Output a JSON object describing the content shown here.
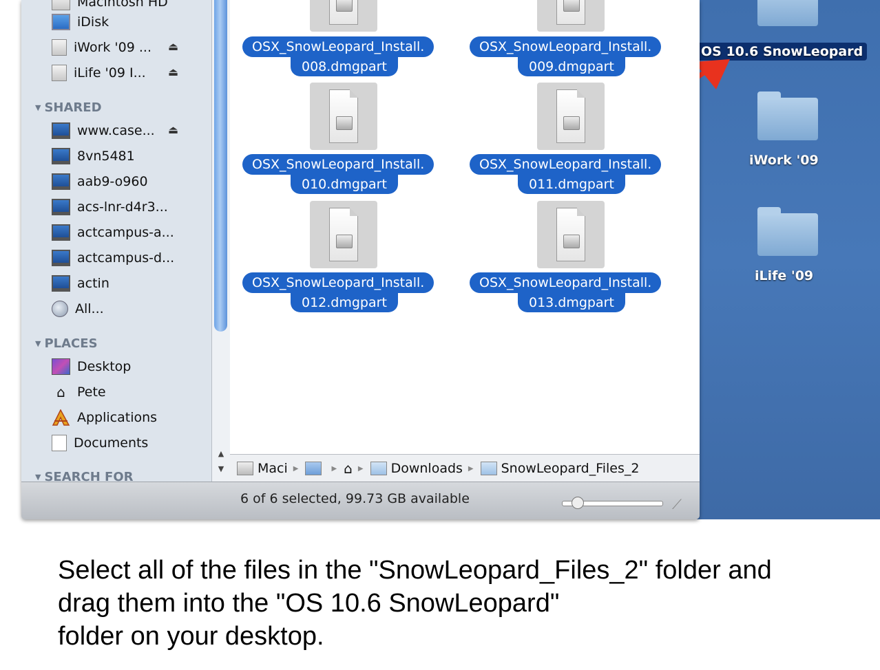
{
  "sidebar": {
    "devices": [
      {
        "label": "Macintosh HD",
        "icon": "hard-disk-icon"
      },
      {
        "label": "iDisk",
        "icon": "idisk-icon"
      },
      {
        "label": "iWork '09 ...",
        "icon": "disk-image-icon",
        "eject": true
      },
      {
        "label": "iLife '09 I...",
        "icon": "disk-image-icon",
        "eject": true
      }
    ],
    "shared_heading": "SHARED",
    "shared": [
      {
        "label": "www.case...",
        "eject": true
      },
      {
        "label": "8vn5481"
      },
      {
        "label": "aab9-o960"
      },
      {
        "label": "acs-lnr-d4r3..."
      },
      {
        "label": "actcampus-a..."
      },
      {
        "label": "actcampus-d..."
      },
      {
        "label": "actin"
      },
      {
        "label": "All..."
      }
    ],
    "places_heading": "PLACES",
    "places": [
      {
        "label": "Desktop"
      },
      {
        "label": "Pete"
      },
      {
        "label": "Applications"
      },
      {
        "label": "Documents"
      }
    ],
    "search_heading": "SEARCH FOR",
    "eject_glyph": "⏏"
  },
  "files": [
    {
      "line1": "OSX_SnowLeopard_Install.",
      "line2": "008.dmgpart"
    },
    {
      "line1": "OSX_SnowLeopard_Install.",
      "line2": "009.dmgpart"
    },
    {
      "line1": "OSX_SnowLeopard_Install.",
      "line2": "010.dmgpart"
    },
    {
      "line1": "OSX_SnowLeopard_Install.",
      "line2": "011.dmgpart"
    },
    {
      "line1": "OSX_SnowLeopard_Install.",
      "line2": "012.dmgpart"
    },
    {
      "line1": "OSX_SnowLeopard_Install.",
      "line2": "013.dmgpart"
    }
  ],
  "pathbar": {
    "items": [
      "Maci",
      "",
      "",
      "Downloads",
      "SnowLeopard_Files_2"
    ],
    "separator": "▶"
  },
  "status": {
    "text": "6 of 6 selected, 99.73 GB available",
    "zoom_level": 0.1
  },
  "desktop": {
    "folders": [
      {
        "label": "OS 10.6 SnowLeopard",
        "selected": true
      },
      {
        "label": "iWork '09"
      },
      {
        "label": "iLife '09"
      }
    ]
  },
  "instruction": {
    "line1": "Select all of the files in the \"SnowLeopard_Files_2\" folder and",
    "line2": "drag them into the \"OS 10.6 SnowLeopard\"",
    "line3": "folder on your desktop."
  },
  "colors": {
    "selection": "#1e63c8",
    "desktop": "#4778b8",
    "arrow": "#e8321e"
  }
}
